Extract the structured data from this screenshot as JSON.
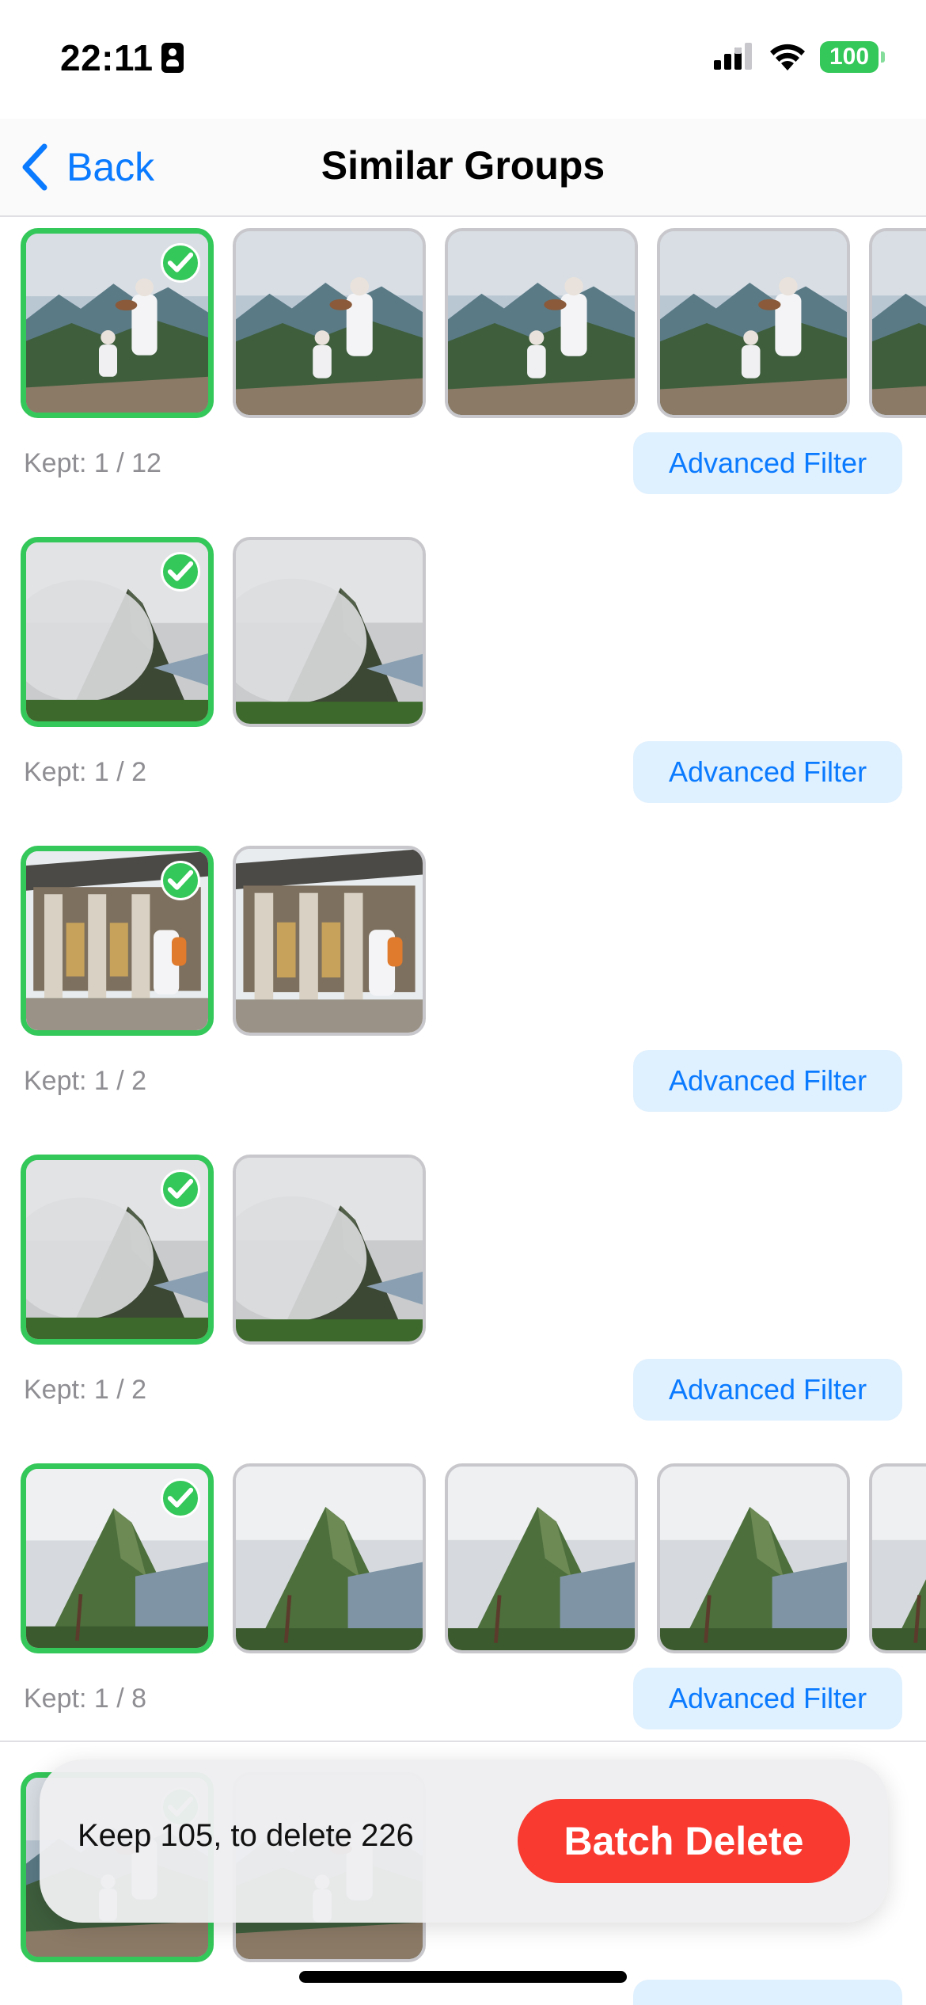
{
  "status_bar": {
    "time": "22:11",
    "battery": "100"
  },
  "nav": {
    "back_label": "Back",
    "title": "Similar Groups"
  },
  "groups": [
    {
      "kept_text": "Kept: 1 / 12",
      "filter_label": "Advanced Filter",
      "scene": "people",
      "thumb_count": 5
    },
    {
      "kept_text": "Kept: 1 / 2",
      "filter_label": "Advanced Filter",
      "scene": "fog-peak",
      "thumb_count": 2
    },
    {
      "kept_text": "Kept: 1 / 2",
      "filter_label": "Advanced Filter",
      "scene": "shrine",
      "thumb_count": 2
    },
    {
      "kept_text": "Kept: 1 / 2",
      "filter_label": "Advanced Filter",
      "scene": "fog-peak",
      "thumb_count": 2
    },
    {
      "kept_text": "Kept: 1 / 8",
      "filter_label": "Advanced Filter",
      "scene": "green-peak",
      "thumb_count": 5
    }
  ],
  "action_bar": {
    "summary": "Keep 105, to delete 226",
    "batch_delete_label": "Batch Delete"
  },
  "colors": {
    "accent": "#0a7aff",
    "kept_border": "#34c759",
    "delete": "#f93a30",
    "filter_bg": "#dff0fe"
  },
  "icons": [
    "id-badge-icon",
    "cellular-icon",
    "wifi-icon",
    "battery-icon",
    "chevron-left-icon",
    "checkmark-icon"
  ]
}
